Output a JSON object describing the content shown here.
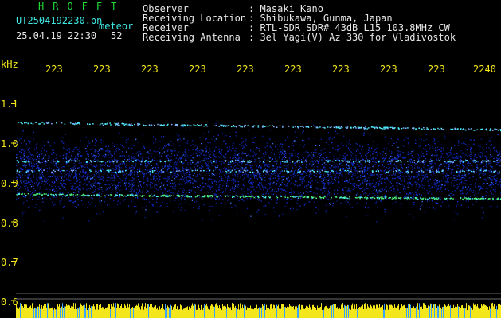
{
  "header": {
    "brand": "HROFFT",
    "filename": "UT2504192230.pn",
    "mode": "meteor",
    "datetime": "25.04.19 22:30",
    "count": "52",
    "fields": [
      {
        "label": "Observer",
        "value": ": Masaki Kano"
      },
      {
        "label": "Receiving Location",
        "value": ": Shibukawa, Gunma, Japan"
      },
      {
        "label": "Receiver",
        "value": ": RTL-SDR SDR# 43dB L15 103.8MHz CW"
      },
      {
        "label": "Receiving Antenna",
        "value": ": 3el Yagi(V) Az 330 for Vladivostok"
      }
    ]
  },
  "colors": {
    "background": "#000000",
    "label_yellow": "#f3e61a",
    "brand_green": "#1fdc37",
    "meta_cyan": "#3ee8e3",
    "text_white": "#e8e8e8",
    "noise_blue": "#1433d8",
    "trace_cyan": "#4ef0ff",
    "trace_green": "#4df07a"
  },
  "chart_data": {
    "type": "heatmap",
    "ylabel": "kHz",
    "yticks": [
      "1.1",
      "1.0",
      "0.9",
      "0.8",
      "0.7",
      "0.6"
    ],
    "ylim": [
      0.59,
      1.17
    ],
    "xticks": [
      "223",
      "223",
      "223",
      "223",
      "223",
      "223",
      "223",
      "223",
      "223",
      "2240"
    ],
    "noise_band": [
      0.8,
      1.05
    ],
    "traces": [
      {
        "start_khz": 1.053,
        "end_khz": 1.035,
        "strength": 0.9
      },
      {
        "start_khz": 0.955,
        "end_khz": 0.955,
        "strength": 0.5
      },
      {
        "start_khz": 0.93,
        "end_khz": 0.93,
        "strength": 0.4
      },
      {
        "start_khz": 0.871,
        "end_khz": 0.859,
        "strength": 1.0
      }
    ],
    "bottom_band": "yellow"
  }
}
